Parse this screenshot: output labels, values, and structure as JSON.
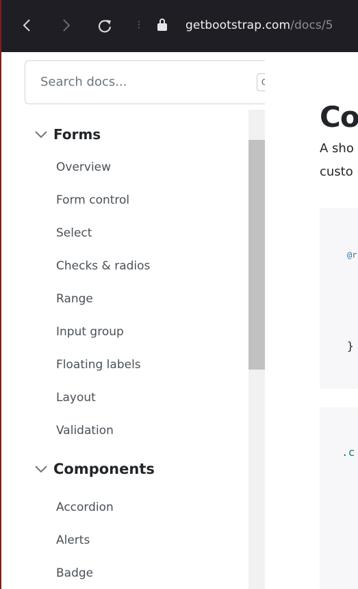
{
  "browser": {
    "back_icon": "chevron-left-icon",
    "forward_icon": "chevron-right-icon",
    "reload_icon": "reload-icon",
    "lock_icon": "lock-icon",
    "url_host": "getbootstrap.com",
    "url_path": "/docs/5"
  },
  "search": {
    "placeholder": "Search docs...",
    "shortcut": "Ctrl + /"
  },
  "sidebar": {
    "groups": [
      {
        "label": "Forms",
        "items": [
          "Overview",
          "Form control",
          "Select",
          "Checks & radios",
          "Range",
          "Input group",
          "Floating labels",
          "Layout",
          "Validation"
        ]
      },
      {
        "label": "Components",
        "items": [
          "Accordion",
          "Alerts",
          "Badge"
        ]
      }
    ]
  },
  "content": {
    "heading": "Co",
    "para_line1": "A sho",
    "para_line2": "custo",
    "code1_token1": "@r",
    "code1_token2": "}",
    "code2_token1": ".c"
  },
  "colors": {
    "browser_bar": "#1f1e24",
    "accent_code_blue": "#2f6f9f",
    "accent_code_teal": "#1f7a7a"
  }
}
